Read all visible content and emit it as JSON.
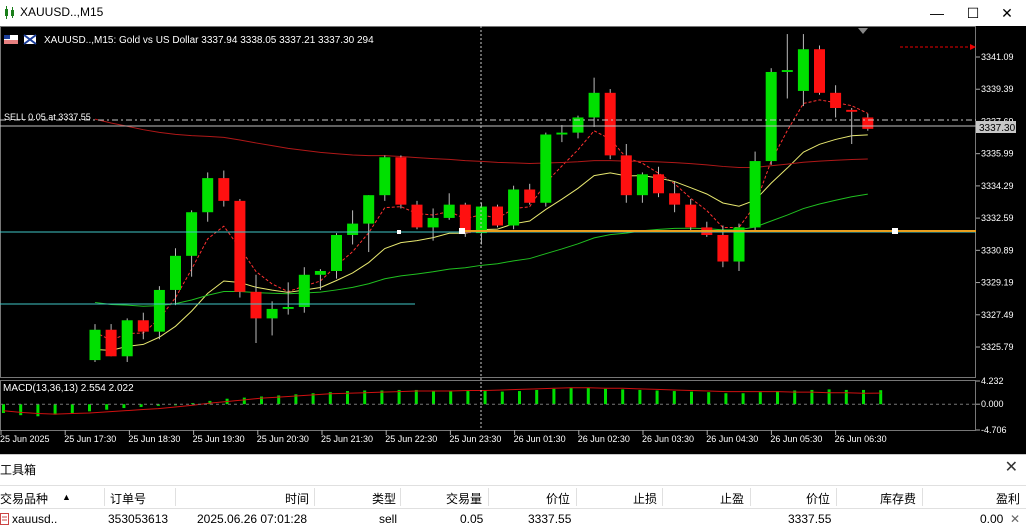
{
  "window": {
    "title": "XAUUSD..,M15",
    "minimize_glyph": "—",
    "maximize_glyph": "☐",
    "close_glyph": "✕"
  },
  "chart": {
    "info_line": "XAUUSD..,M15:  Gold vs US Dollar  3337.94 3338.05 3337.21 3337.30  294",
    "order_label": "SELL 0.05 at 3337.55",
    "current_price_tag": "3337.30",
    "price_axis": [
      "3341.09",
      "3339.39",
      "3337.69",
      "3335.99",
      "3334.29",
      "3332.59",
      "3330.89",
      "3329.19",
      "3327.49",
      "3325.79"
    ],
    "macd_label": "MACD(13,36,13) 2.554 2.022",
    "macd_axis": [
      "4.232",
      "0.000",
      "-4.706"
    ],
    "time_axis": [
      "25 Jun 2025",
      "25 Jun 17:30",
      "25 Jun 18:30",
      "25 Jun 19:30",
      "25 Jun 20:30",
      "25 Jun 21:30",
      "25 Jun 22:30",
      "25 Jun 23:30",
      "26 Jun 01:30",
      "26 Jun 02:30",
      "26 Jun 03:30",
      "26 Jun 04:30",
      "26 Jun 05:30",
      "26 Jun 06:30"
    ],
    "colors": {
      "bull": "#00e000",
      "bear": "#ff1010",
      "background": "#000000"
    }
  },
  "chart_data": {
    "type": "candlestick",
    "symbol": "XAUUSD..",
    "timeframe": "M15",
    "ylim": [
      3325.0,
      3342.3
    ],
    "candles": [
      {
        "o": 3325.1,
        "h": 3327.0,
        "l": 3325.0,
        "c": 3326.7
      },
      {
        "o": 3326.7,
        "h": 3327.0,
        "l": 3325.3,
        "c": 3325.3
      },
      {
        "o": 3325.3,
        "h": 3327.3,
        "l": 3325.0,
        "c": 3327.2
      },
      {
        "o": 3327.2,
        "h": 3327.6,
        "l": 3326.2,
        "c": 3326.6
      },
      {
        "o": 3326.6,
        "h": 3329.0,
        "l": 3326.2,
        "c": 3328.8
      },
      {
        "o": 3328.8,
        "h": 3331.0,
        "l": 3328.0,
        "c": 3330.6
      },
      {
        "o": 3330.6,
        "h": 3333.0,
        "l": 3329.5,
        "c": 3332.9
      },
      {
        "o": 3332.9,
        "h": 3335.0,
        "l": 3332.4,
        "c": 3334.7
      },
      {
        "o": 3334.7,
        "h": 3335.1,
        "l": 3333.2,
        "c": 3333.5
      },
      {
        "o": 3333.5,
        "h": 3333.6,
        "l": 3328.4,
        "c": 3328.7
      },
      {
        "o": 3328.7,
        "h": 3329.6,
        "l": 3326.0,
        "c": 3327.3
      },
      {
        "o": 3327.3,
        "h": 3328.2,
        "l": 3326.4,
        "c": 3327.8
      },
      {
        "o": 3327.8,
        "h": 3329.2,
        "l": 3327.5,
        "c": 3327.9
      },
      {
        "o": 3327.9,
        "h": 3330.0,
        "l": 3327.6,
        "c": 3329.6
      },
      {
        "o": 3329.6,
        "h": 3329.9,
        "l": 3328.8,
        "c": 3329.8
      },
      {
        "o": 3329.8,
        "h": 3331.8,
        "l": 3329.4,
        "c": 3331.7
      },
      {
        "o": 3331.7,
        "h": 3333.0,
        "l": 3331.2,
        "c": 3332.3
      },
      {
        "o": 3332.3,
        "h": 3333.8,
        "l": 3330.8,
        "c": 3333.8
      },
      {
        "o": 3333.8,
        "h": 3335.9,
        "l": 3333.5,
        "c": 3335.8
      },
      {
        "o": 3335.8,
        "h": 3335.9,
        "l": 3333.1,
        "c": 3333.3
      },
      {
        "o": 3333.3,
        "h": 3333.5,
        "l": 3332.0,
        "c": 3332.1
      },
      {
        "o": 3332.1,
        "h": 3333.1,
        "l": 3331.4,
        "c": 3332.6
      },
      {
        "o": 3332.6,
        "h": 3333.9,
        "l": 3332.5,
        "c": 3333.3
      },
      {
        "o": 3333.3,
        "h": 3333.4,
        "l": 3331.6,
        "c": 3331.8
      },
      {
        "o": 3331.8,
        "h": 3333.4,
        "l": 3331.2,
        "c": 3333.2
      },
      {
        "o": 3333.2,
        "h": 3333.3,
        "l": 3332.1,
        "c": 3332.2
      },
      {
        "o": 3332.2,
        "h": 3334.3,
        "l": 3332.0,
        "c": 3334.1
      },
      {
        "o": 3334.1,
        "h": 3334.4,
        "l": 3333.3,
        "c": 3333.4
      },
      {
        "o": 3333.4,
        "h": 3337.1,
        "l": 3333.2,
        "c": 3337.0
      },
      {
        "o": 3337.0,
        "h": 3337.5,
        "l": 3336.6,
        "c": 3337.1
      },
      {
        "o": 3337.1,
        "h": 3338.0,
        "l": 3336.8,
        "c": 3337.9
      },
      {
        "o": 3337.9,
        "h": 3340.0,
        "l": 3337.4,
        "c": 3339.2
      },
      {
        "o": 3339.2,
        "h": 3339.4,
        "l": 3335.7,
        "c": 3335.9
      },
      {
        "o": 3335.9,
        "h": 3336.5,
        "l": 3333.4,
        "c": 3333.8
      },
      {
        "o": 3333.8,
        "h": 3335.0,
        "l": 3333.4,
        "c": 3334.9
      },
      {
        "o": 3334.9,
        "h": 3335.3,
        "l": 3333.7,
        "c": 3333.9
      },
      {
        "o": 3333.9,
        "h": 3334.5,
        "l": 3332.9,
        "c": 3333.3
      },
      {
        "o": 3333.3,
        "h": 3333.6,
        "l": 3331.9,
        "c": 3332.1
      },
      {
        "o": 3332.1,
        "h": 3332.4,
        "l": 3331.6,
        "c": 3331.7
      },
      {
        "o": 3331.7,
        "h": 3332.2,
        "l": 3330.0,
        "c": 3330.3
      },
      {
        "o": 3330.3,
        "h": 3332.3,
        "l": 3329.8,
        "c": 3332.1
      },
      {
        "o": 3332.1,
        "h": 3336.1,
        "l": 3331.9,
        "c": 3335.6
      },
      {
        "o": 3335.6,
        "h": 3340.5,
        "l": 3335.4,
        "c": 3340.3
      },
      {
        "o": 3340.3,
        "h": 3342.3,
        "l": 3338.9,
        "c": 3340.4
      },
      {
        "o": 3339.3,
        "h": 3342.3,
        "l": 3338.5,
        "c": 3341.5
      },
      {
        "o": 3341.5,
        "h": 3341.7,
        "l": 3339.1,
        "c": 3339.2
      },
      {
        "o": 3339.2,
        "h": 3339.6,
        "l": 3337.9,
        "c": 3338.4
      },
      {
        "o": 3338.3,
        "h": 3338.4,
        "l": 3336.5,
        "c": 3338.2
      },
      {
        "o": 3337.9,
        "h": 3338.1,
        "l": 3337.2,
        "c": 3337.3
      }
    ],
    "macd_histogram": [
      -1.6,
      -2.0,
      -2.2,
      -1.9,
      -1.6,
      -1.3,
      -1.0,
      -0.7,
      -0.5,
      -0.3,
      -0.2,
      0.2,
      0.6,
      1.0,
      1.2,
      1.4,
      1.6,
      1.8,
      2.0,
      2.2,
      2.4,
      2.5,
      2.5,
      2.6,
      2.6,
      2.5,
      2.5,
      2.4,
      2.4,
      2.3,
      2.4,
      2.6,
      2.8,
      3.0,
      3.0,
      2.8,
      2.7,
      2.6,
      2.5,
      2.4,
      2.3,
      2.2,
      2.0,
      2.0,
      2.2,
      2.4,
      2.5,
      2.6,
      2.7,
      2.6,
      2.6,
      2.554
    ],
    "macd_signal": [
      -1.2,
      -1.5,
      -1.7,
      -1.8,
      -1.7,
      -1.6,
      -1.4,
      -1.2,
      -1.0,
      -0.8,
      -0.5,
      -0.2,
      0.2,
      0.5,
      0.8,
      1.1,
      1.3,
      1.5,
      1.7,
      1.9,
      2.0,
      2.1,
      2.2,
      2.3,
      2.4,
      2.4,
      2.4,
      2.5,
      2.5,
      2.6,
      2.7,
      2.8,
      2.9,
      3.0,
      3.0,
      2.9,
      2.9,
      2.8,
      2.7,
      2.6,
      2.5,
      2.4,
      2.3,
      2.3,
      2.3,
      2.3,
      2.2,
      2.2,
      2.1,
      2.1,
      2.0,
      2.022
    ],
    "macd_ylim": [
      -4.706,
      4.232
    ]
  },
  "toolbox": {
    "title": "工具箱",
    "close_glyph": "✕",
    "columns": [
      "交易品种",
      "订单号",
      "时间",
      "类型",
      "交易量",
      "价位",
      "止损",
      "止盈",
      "价位",
      "库存费",
      "盈利"
    ],
    "sort_glyph": "▲",
    "row": {
      "symbol": "xauusd..",
      "order": "353053613",
      "time": "2025.06.26 07:01:28",
      "type": "sell",
      "volume": "0.05",
      "open_price": "3337.55",
      "sl": "",
      "tp": "",
      "price": "3337.55",
      "swap": "",
      "profit": "0.00",
      "close_glyph": "✕"
    }
  }
}
